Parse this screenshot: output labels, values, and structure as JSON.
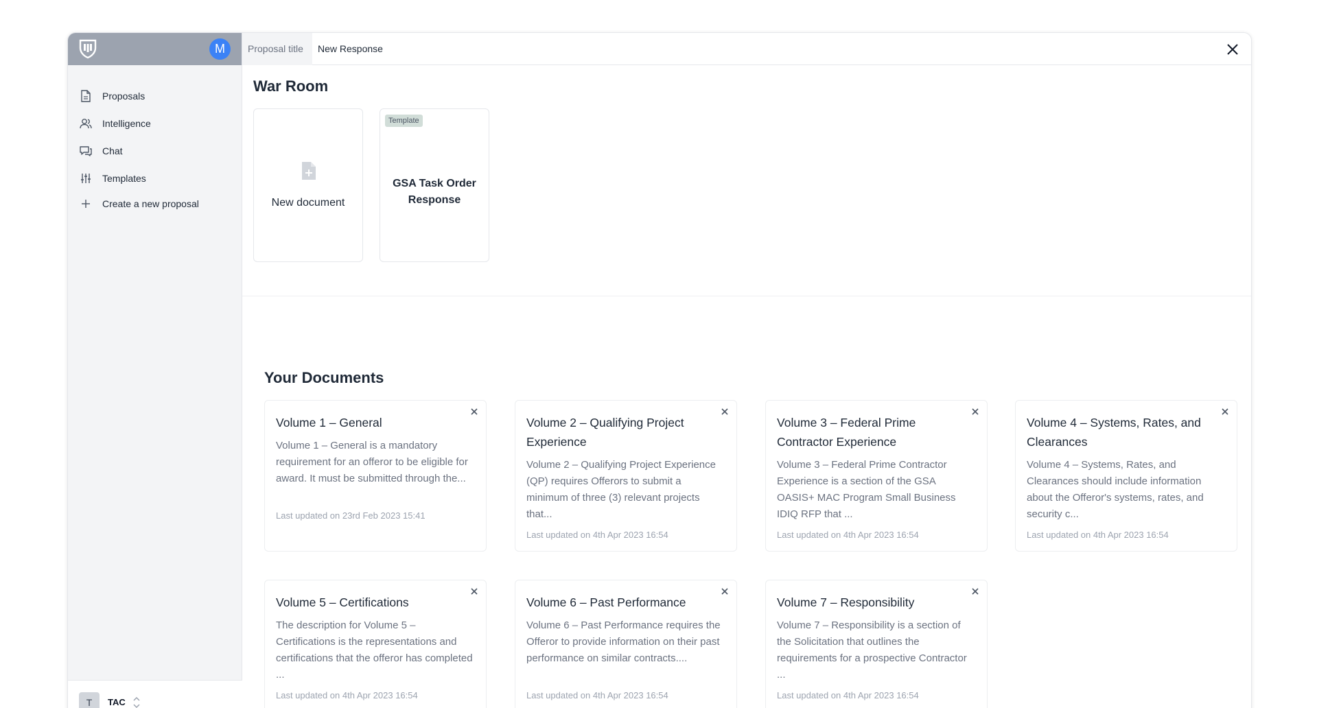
{
  "sidebar": {
    "avatar_initial": "M",
    "items": [
      {
        "label": "Proposals",
        "icon": "document-icon"
      },
      {
        "label": "Intelligence",
        "icon": "users-icon"
      },
      {
        "label": "Chat",
        "icon": "chat-icon"
      },
      {
        "label": "Templates",
        "icon": "sliders-icon"
      },
      {
        "label": "Create a new proposal",
        "icon": "plus-icon"
      }
    ],
    "workspace": {
      "initial": "T",
      "name": "TAC"
    }
  },
  "tabs": [
    "Proposal title",
    "New Response"
  ],
  "war_room": {
    "title": "War Room",
    "new_document_label": "New document",
    "template_badge": "Template",
    "template_name": "GSA Task Order Response"
  },
  "documents": {
    "title": "Your Documents",
    "cards": [
      {
        "title": "Volume 1 – General",
        "description": "Volume 1 – General is a mandatory requirement for an offeror to be eligible for award. It must be submitted through the...",
        "updated": "Last updated on 23rd Feb 2023 15:41"
      },
      {
        "title": "Volume 2 – Qualifying Project Experience",
        "description": "Volume 2 – Qualifying Project Experience (QP) requires Offerors to submit a minimum of three (3) relevant projects that...",
        "updated": "Last updated on 4th Apr 2023 16:54"
      },
      {
        "title": "Volume 3 – Federal Prime Contractor Experience",
        "description": "Volume 3 – Federal Prime Contractor Experience is a section of the GSA OASIS+ MAC Program Small Business IDIQ RFP that ...",
        "updated": "Last updated on 4th Apr 2023 16:54"
      },
      {
        "title": "Volume 4 – Systems, Rates, and Clearances",
        "description": "Volume 4 – Systems, Rates, and Clearances should include information about the Offeror's systems, rates, and security c...",
        "updated": "Last updated on 4th Apr 2023 16:54"
      },
      {
        "title": "Volume 5 – Certifications",
        "description": "The description for Volume 5 – Certifications is the representations and certifications that the offeror has completed ...",
        "updated": "Last updated on 4th Apr 2023 16:54"
      },
      {
        "title": "Volume 6 – Past Performance",
        "description": "Volume 6 – Past Performance requires the Offeror to provide information on their past performance on similar contracts....",
        "updated": "Last updated on 4th Apr 2023 16:54"
      },
      {
        "title": "Volume 7 – Responsibility",
        "description": "Volume 7 – Responsibility is a section of the Solicitation that outlines the requirements for a prospective Contractor ...",
        "updated": "Last updated on 4th Apr 2023 16:54"
      }
    ]
  }
}
